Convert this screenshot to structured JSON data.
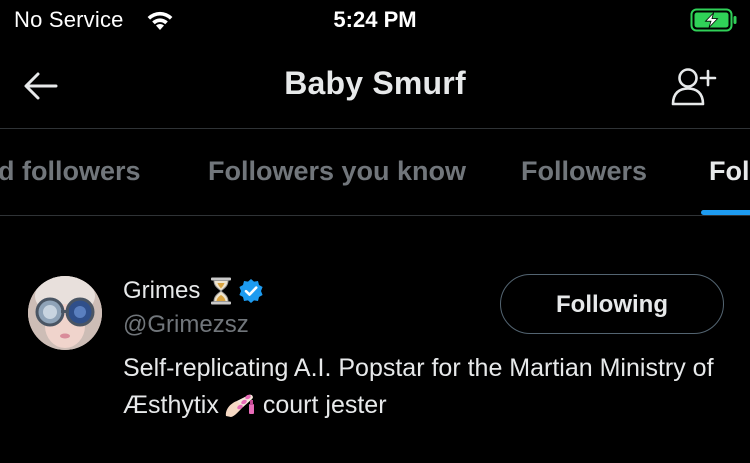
{
  "status_bar": {
    "carrier": "No Service",
    "time": "5:24 PM",
    "wifi_icon": "wifi-icon",
    "battery_icon": "battery-charging-icon",
    "battery_color": "#30d158"
  },
  "header": {
    "title": "Baby Smurf",
    "back_icon": "arrow-left-icon",
    "add_user_icon": "add-user-icon"
  },
  "tabs": [
    {
      "label": "Verified followers",
      "visible_label": "d followers",
      "active": false
    },
    {
      "label": "Followers you know",
      "active": false
    },
    {
      "label": "Followers",
      "active": false
    },
    {
      "label": "Following",
      "visible_label": "Fol",
      "active": true
    }
  ],
  "accent_color": "#1d9bf0",
  "users": [
    {
      "display_name": "Grimes",
      "name_emoji": "hourglass-icon",
      "verified": true,
      "handle": "@Grimezsz",
      "bio_part1": "Self-replicating A.I. Popstar for the Martian Ministry of Æsthytix",
      "bio_emoji": "nail-polish-icon",
      "bio_part2": "court jester",
      "follow_button_label": "Following"
    }
  ]
}
